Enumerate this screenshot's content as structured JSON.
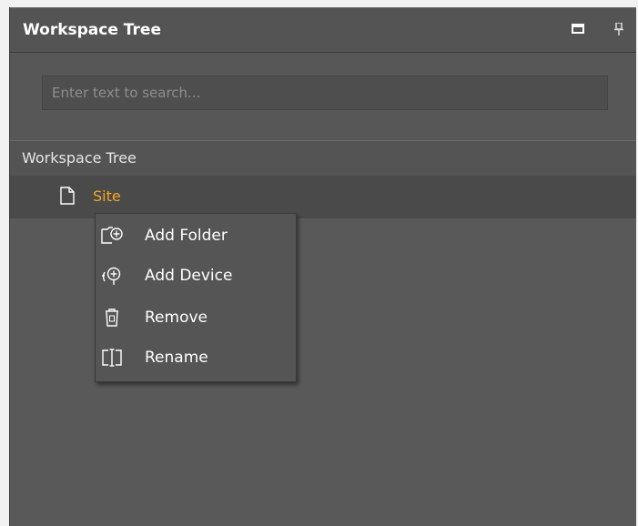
{
  "panel": {
    "title": "Workspace Tree",
    "restore_icon": "window-restore-icon",
    "pin_icon": "pin-icon"
  },
  "search": {
    "placeholder": "Enter text to search...",
    "value": ""
  },
  "tree": {
    "header": "Workspace Tree",
    "nodes": [
      {
        "label": "Site",
        "icon": "document-icon",
        "color": "#f5a623"
      }
    ]
  },
  "context_menu": {
    "items": [
      {
        "label": "Add Folder",
        "icon": "add-folder-icon"
      },
      {
        "label": "Add Device",
        "icon": "add-device-icon"
      },
      {
        "label": "Remove",
        "icon": "trash-icon"
      },
      {
        "label": "Rename",
        "icon": "rename-icon"
      }
    ]
  },
  "colors": {
    "panel_bg": "#595959",
    "accent": "#f5a623",
    "text": "#ffffff"
  }
}
